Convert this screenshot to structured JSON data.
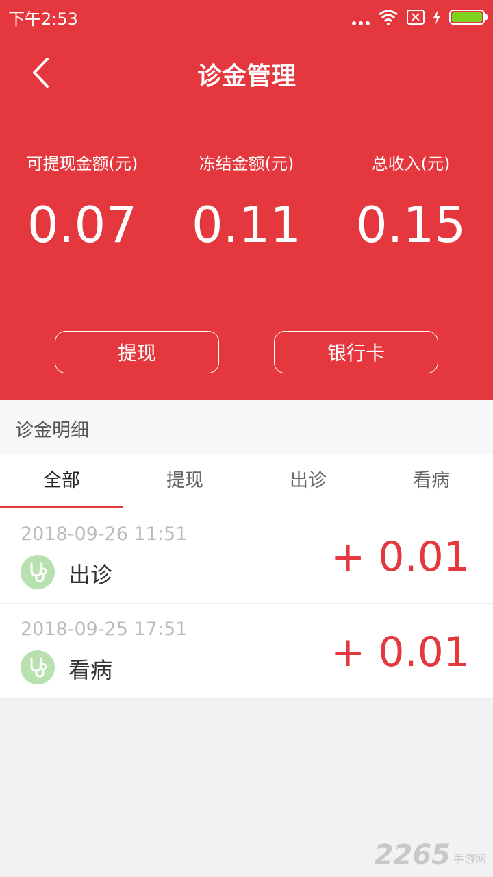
{
  "status_bar": {
    "time": "下午2:53"
  },
  "header": {
    "title": "诊金管理",
    "stats": [
      {
        "label": "可提现金额(元)",
        "value": "0.07"
      },
      {
        "label": "冻结金额(元)",
        "value": "0.11"
      },
      {
        "label": "总收入(元)",
        "value": "0.15"
      }
    ],
    "withdraw_label": "提现",
    "bank_card_label": "银行卡"
  },
  "section": {
    "title": "诊金明细"
  },
  "tabs": [
    {
      "label": "全部",
      "active": true
    },
    {
      "label": "提现",
      "active": false
    },
    {
      "label": "出诊",
      "active": false
    },
    {
      "label": "看病",
      "active": false
    }
  ],
  "records": [
    {
      "time": "2018-09-26 11:51",
      "type": "出诊",
      "amount": "+ 0.01",
      "icon": "stethoscope-icon"
    },
    {
      "time": "2018-09-25 17:51",
      "type": "看病",
      "amount": "+ 0.01",
      "icon": "stethoscope-icon"
    }
  ],
  "watermark": {
    "number": "2265",
    "text": "手游网"
  },
  "colors": {
    "brand_red": "#e4383e",
    "icon_green": "#b9e1b0",
    "battery_green": "#7ed321"
  }
}
